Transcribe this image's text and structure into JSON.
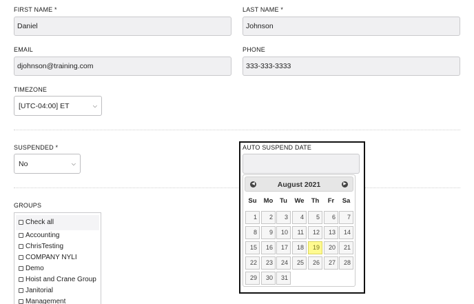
{
  "form": {
    "first_name": {
      "label": "FIRST NAME *",
      "value": "Daniel"
    },
    "last_name": {
      "label": "LAST NAME *",
      "value": "Johnson"
    },
    "email": {
      "label": "EMAIL",
      "value": "djohnson@training.com"
    },
    "phone": {
      "label": "PHONE",
      "value": "333-333-3333"
    },
    "timezone": {
      "label": "TIMEZONE",
      "value": "[UTC-04:00] ET"
    },
    "suspended": {
      "label": "SUSPENDED *",
      "value": "No"
    },
    "auto_suspend": {
      "label": "AUTO SUSPEND DATE",
      "value": ""
    }
  },
  "groups": {
    "label": "GROUPS",
    "check_all": "Check all",
    "items": [
      "Accounting",
      "ChrisTesting",
      "COMPANY NYLI",
      "Demo",
      "Hoist and Crane Group",
      "Janitorial",
      "Management"
    ]
  },
  "datepicker": {
    "title": "August 2021",
    "prev_icon": "chevron-left-circle-icon",
    "next_icon": "chevron-right-circle-icon",
    "weekdays": [
      "Su",
      "Mo",
      "Tu",
      "We",
      "Th",
      "Fr",
      "Sa"
    ],
    "weeks": [
      [
        "1",
        "2",
        "3",
        "4",
        "5",
        "6",
        "7"
      ],
      [
        "8",
        "9",
        "10",
        "11",
        "12",
        "13",
        "14"
      ],
      [
        "15",
        "16",
        "17",
        "18",
        "19",
        "20",
        "21"
      ],
      [
        "22",
        "23",
        "24",
        "25",
        "26",
        "27",
        "28"
      ],
      [
        "29",
        "30",
        "31"
      ]
    ],
    "today": "19",
    "today_color": "#fffa90"
  }
}
